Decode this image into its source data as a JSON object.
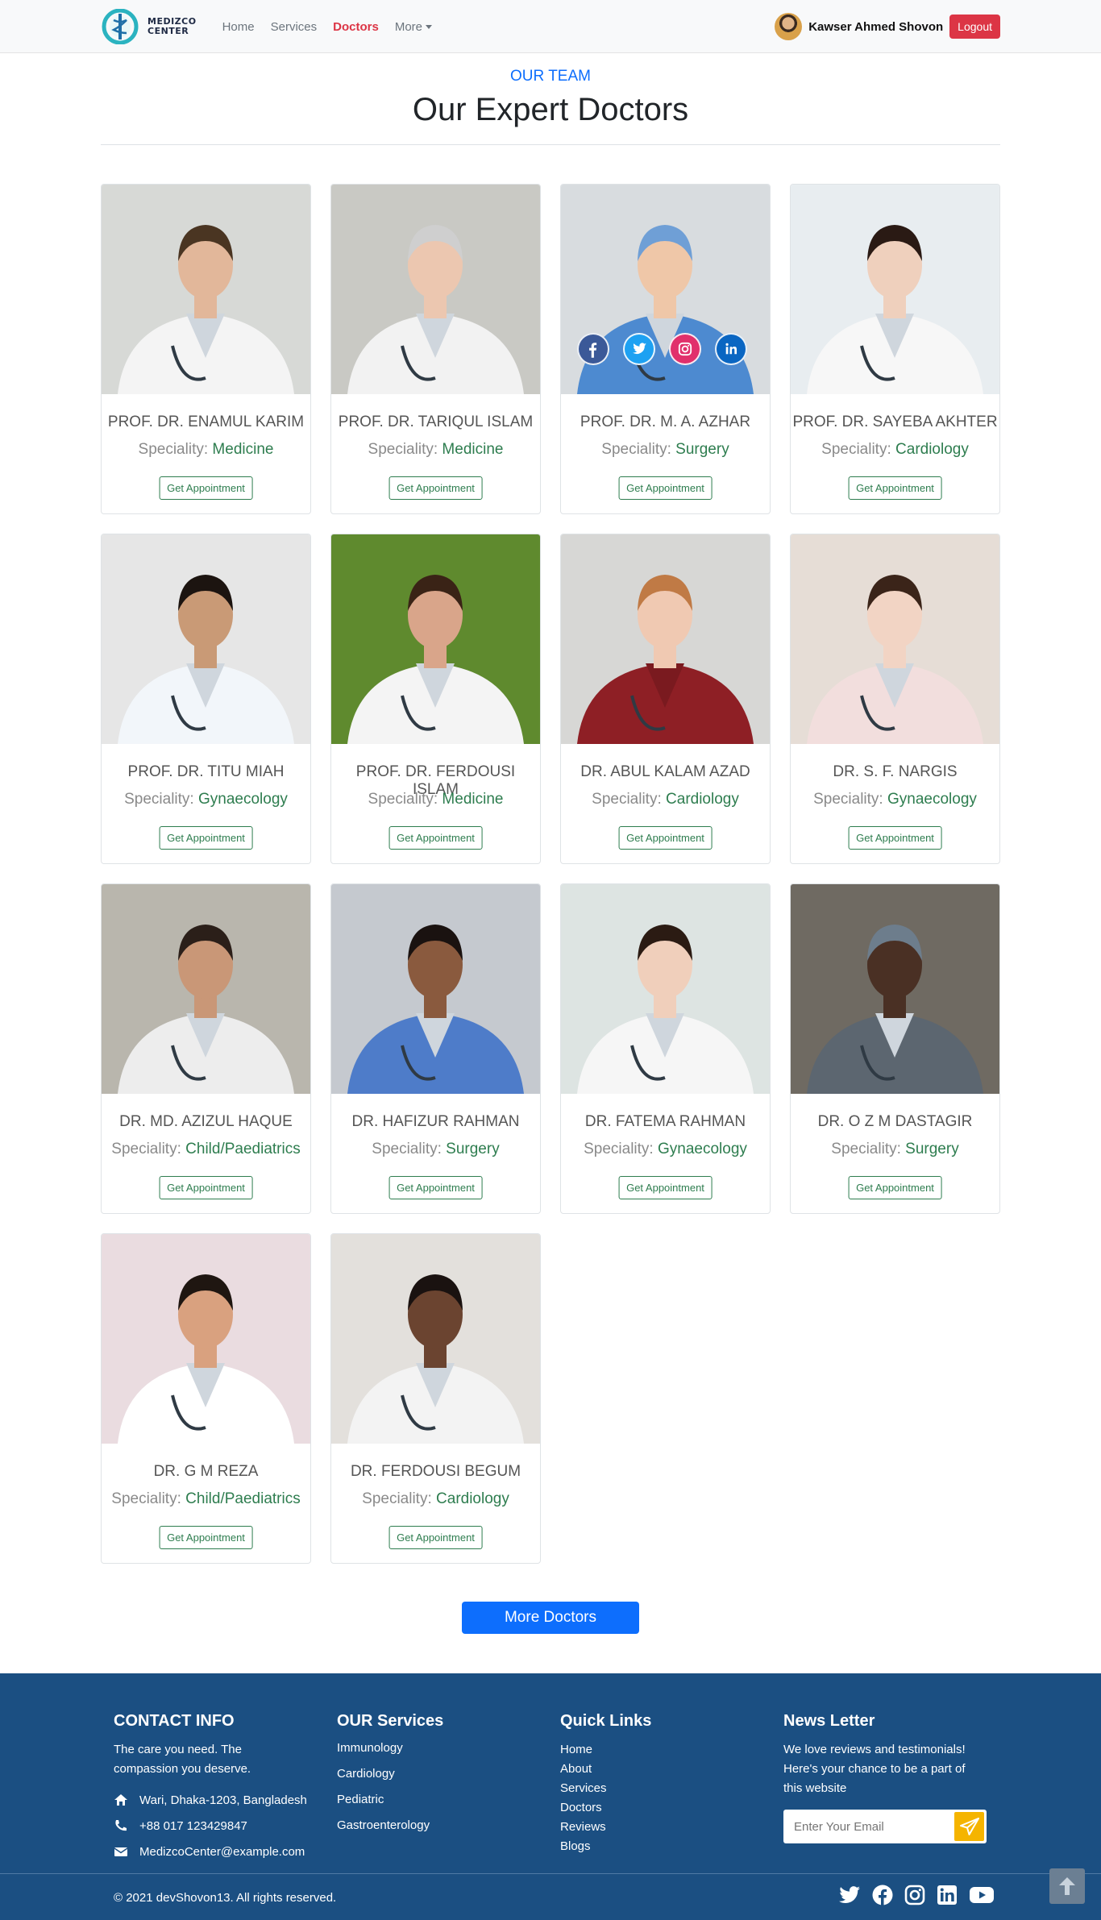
{
  "nav": {
    "brand_line1": "MEDIZCO",
    "brand_line2": "CENTER",
    "links": [
      "Home",
      "Services",
      "Doctors",
      "More"
    ],
    "user_name": "Kawser Ahmed Shovon",
    "logout_label": "Logout",
    "accent": "#dc3545"
  },
  "section": {
    "eyebrow": "OUR TEAM",
    "title": "Our Expert Doctors"
  },
  "speciality_label": "Speciality:",
  "appointment_label": "Get Appointment",
  "doctors": [
    {
      "name": "PROF. DR. ENAMUL KARIM",
      "speciality": "Medicine"
    },
    {
      "name": "PROF. DR. TARIQUL ISLAM",
      "speciality": "Medicine"
    },
    {
      "name": "PROF. DR. M. A. AZHAR",
      "speciality": "Surgery"
    },
    {
      "name": "PROF. DR. SAYEBA AKHTER",
      "speciality": "Cardiology"
    },
    {
      "name": "PROF. DR. TITU MIAH",
      "speciality": "Gynaecology"
    },
    {
      "name": "PROF. DR. FERDOUSI ISLAM",
      "speciality": "Medicine"
    },
    {
      "name": "DR. ABUL KALAM AZAD",
      "speciality": "Cardiology"
    },
    {
      "name": "DR. S. F. NARGIS",
      "speciality": "Gynaecology"
    },
    {
      "name": "DR. MD. AZIZUL HAQUE",
      "speciality": "Child/Paediatrics"
    },
    {
      "name": "DR. HAFIZUR RAHMAN",
      "speciality": "Surgery"
    },
    {
      "name": "DR. FATEMA RAHMAN",
      "speciality": "Gynaecology"
    },
    {
      "name": "DR. O Z M DASTAGIR",
      "speciality": "Surgery"
    },
    {
      "name": "DR. G M REZA",
      "speciality": "Child/Paediatrics"
    },
    {
      "name": "DR. FERDOUSI BEGUM",
      "speciality": "Cardiology"
    }
  ],
  "more_doctors_label": "More Doctors",
  "footer": {
    "contact": {
      "heading": "CONTACT INFO",
      "tagline": "The care you need. The compassion you deserve.",
      "address": "Wari, Dhaka-1203, Bangladesh",
      "phone": "+88 017 123429847",
      "email": "MedizcoCenter@example.com"
    },
    "services": {
      "heading": "OUR Services",
      "items": [
        "Immunology",
        "Cardiology",
        "Pediatric",
        "Gastroenterology"
      ]
    },
    "links": {
      "heading": "Quick Links",
      "items": [
        "Home",
        "About",
        "Services",
        "Doctors",
        "Reviews",
        "Blogs"
      ]
    },
    "newsletter": {
      "heading": "News Letter",
      "text": "We love reviews and testimonials! Here's your chance to be a part of this website",
      "placeholder": "Enter Your Email"
    },
    "copyright": "© 2021 devShovon13. All rights reserved.",
    "bg_color": "#1b4f82"
  }
}
